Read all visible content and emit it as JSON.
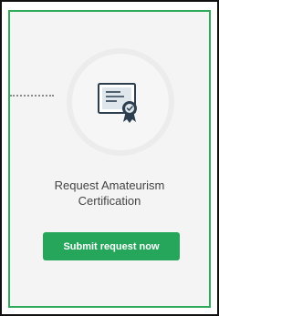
{
  "card": {
    "title_line1": "Request Amateurism",
    "title_line2": "Certification",
    "icon": "certificate-icon",
    "submit_label": "Submit request now"
  },
  "colors": {
    "accent": "#26a65b",
    "card_border": "#2eaa5a",
    "card_background": "#f4f4f4",
    "icon_dark": "#2d3e50",
    "icon_light": "#dfe6ec"
  }
}
